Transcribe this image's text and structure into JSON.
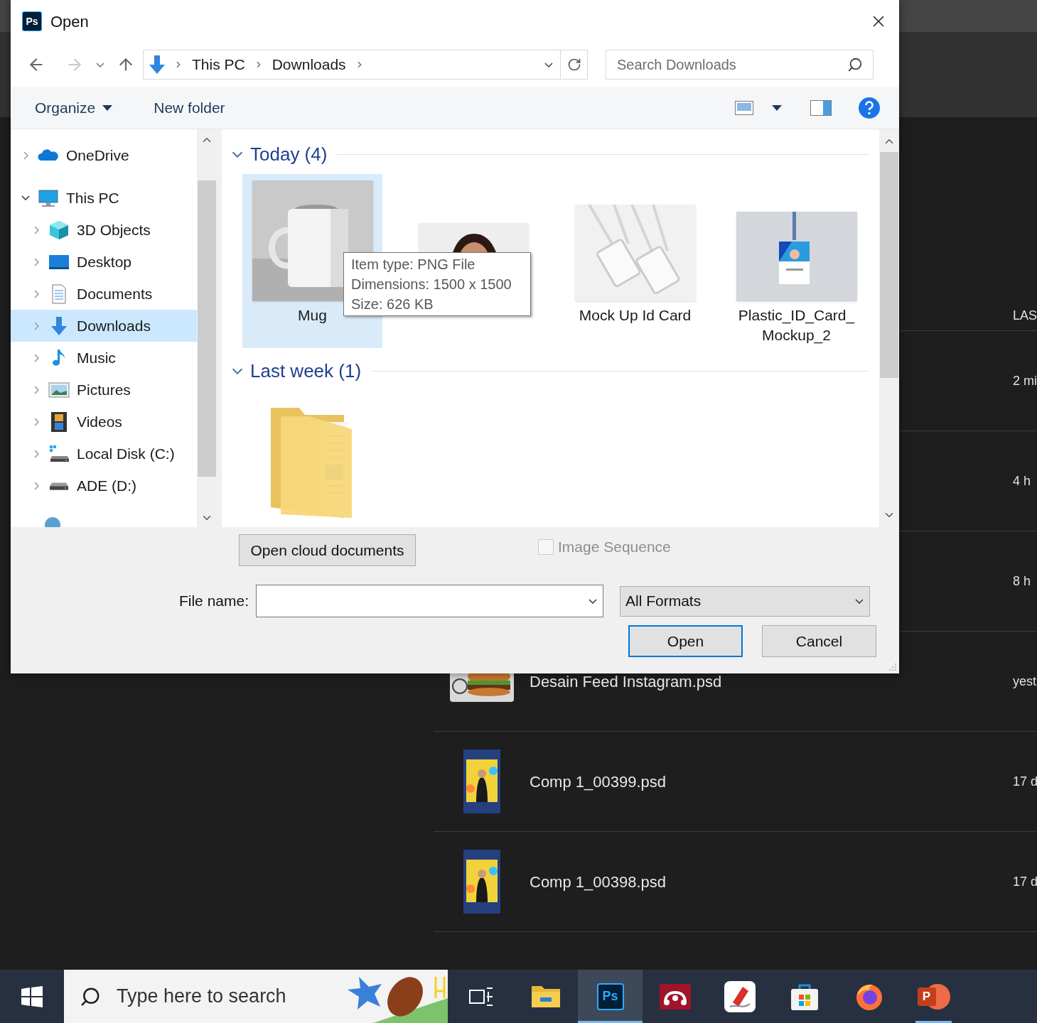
{
  "background": {
    "column_header": "LAS",
    "rows": [
      {
        "time": "2 mi"
      },
      {
        "time": "4 h"
      },
      {
        "time": "8 h"
      },
      {
        "time": "yest",
        "name": "Desain Feed Instagram.psd"
      },
      {
        "time": "17 d",
        "name": "Comp 1_00399.psd"
      },
      {
        "time": "17 d",
        "name": "Comp 1_00398.psd"
      }
    ]
  },
  "dialog": {
    "app_icon": "Ps",
    "title": "Open",
    "nav": {
      "forward_disabled": true,
      "breadcrumb": [
        "This PC",
        "Downloads"
      ],
      "search_placeholder": "Search Downloads"
    },
    "toolbar": {
      "organize": "Organize",
      "new_folder": "New folder"
    },
    "tree": [
      {
        "label": "OneDrive",
        "expanded": false,
        "selected": false
      },
      {
        "label": "This PC",
        "expanded": true,
        "selected": false,
        "children": [
          {
            "label": "3D Objects",
            "expanded": false,
            "selected": false
          },
          {
            "label": "Desktop",
            "expanded": false,
            "selected": false
          },
          {
            "label": "Documents",
            "expanded": false,
            "selected": false
          },
          {
            "label": "Downloads",
            "expanded": false,
            "selected": true
          },
          {
            "label": "Music",
            "expanded": false,
            "selected": false
          },
          {
            "label": "Pictures",
            "expanded": false,
            "selected": false
          },
          {
            "label": "Videos",
            "expanded": false,
            "selected": false
          },
          {
            "label": "Local Disk (C:)",
            "expanded": false,
            "selected": false
          },
          {
            "label": "ADE (D:)",
            "expanded": false,
            "selected": false
          }
        ]
      }
    ],
    "groups": [
      {
        "title": "Today (4)",
        "expanded": true,
        "items": [
          {
            "label_lines": [
              "Mug"
            ],
            "selected": true
          },
          {
            "selected": false
          },
          {
            "label_lines": [
              "Mock Up Id Card"
            ],
            "selected": false
          },
          {
            "label_lines": [
              "Plastic_ID_Card_",
              "Mockup_2"
            ],
            "selected": false
          }
        ]
      },
      {
        "title": "Last week (1)",
        "expanded": true,
        "items": [
          {
            "selected": false
          }
        ]
      }
    ],
    "tooltip": [
      "Item type: PNG File",
      "Dimensions: 1500 x 1500",
      "Size: 626 KB"
    ],
    "cloud_button": "Open cloud documents",
    "image_sequence": {
      "label": "Image Sequence",
      "checked": false,
      "disabled": true
    },
    "file_name": {
      "label": "File name:"
    },
    "filter": "All Formats",
    "buttons": [
      {
        "label": "Open",
        "default": true
      },
      {
        "label": "Cancel",
        "default": false
      }
    ]
  },
  "taskbar": {
    "search_placeholder": "Type here to search",
    "apps": [
      {
        "running": false,
        "active": false
      },
      {
        "running": false,
        "active": false
      },
      {
        "label": "Ps",
        "running": true,
        "active": true
      },
      {
        "running": false,
        "active": false
      },
      {
        "running": false,
        "active": false
      },
      {
        "running": false,
        "active": false
      },
      {
        "running": false,
        "active": false
      },
      {
        "label": "P",
        "running": true,
        "active": false
      }
    ]
  }
}
